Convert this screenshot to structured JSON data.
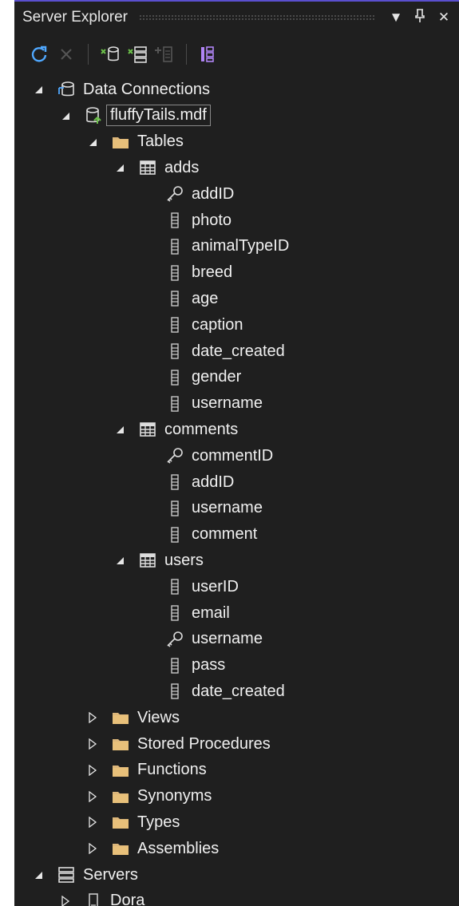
{
  "panel": {
    "title": "Server Explorer",
    "title_icons": [
      "dropdown-arrow-icon",
      "pin-icon",
      "close-icon"
    ],
    "title_glyphs": [
      "▼",
      "🖈",
      "✕"
    ]
  },
  "toolbar": {
    "tools": [
      "refresh-icon",
      "stop-icon",
      "connect-to-database-icon",
      "connect-to-server-icon",
      "add-sharepoint-connection-icon",
      "filter-icon"
    ]
  },
  "tree": [
    {
      "label": "Data Connections",
      "icon": "data-connections",
      "arrow": "expanded",
      "level": 0
    },
    {
      "label": "fluffyTails.mdf",
      "icon": "database",
      "arrow": "expanded",
      "level": 1,
      "selected": true
    },
    {
      "label": "Tables",
      "icon": "folder",
      "arrow": "expanded",
      "level": 2
    },
    {
      "label": "adds",
      "icon": "table",
      "arrow": "expanded",
      "level": 3
    },
    {
      "label": "addID",
      "icon": "key",
      "arrow": "none",
      "level": 4
    },
    {
      "label": "photo",
      "icon": "column",
      "arrow": "none",
      "level": 4
    },
    {
      "label": "animalTypeID",
      "icon": "column",
      "arrow": "none",
      "level": 4
    },
    {
      "label": "breed",
      "icon": "column",
      "arrow": "none",
      "level": 4
    },
    {
      "label": "age",
      "icon": "column",
      "arrow": "none",
      "level": 4
    },
    {
      "label": "caption",
      "icon": "column",
      "arrow": "none",
      "level": 4
    },
    {
      "label": "date_created",
      "icon": "column",
      "arrow": "none",
      "level": 4
    },
    {
      "label": "gender",
      "icon": "column",
      "arrow": "none",
      "level": 4
    },
    {
      "label": "username",
      "icon": "column",
      "arrow": "none",
      "level": 4
    },
    {
      "label": "comments",
      "icon": "table",
      "arrow": "expanded",
      "level": 3
    },
    {
      "label": "commentID",
      "icon": "key",
      "arrow": "none",
      "level": 4
    },
    {
      "label": "addID",
      "icon": "column",
      "arrow": "none",
      "level": 4
    },
    {
      "label": "username",
      "icon": "column",
      "arrow": "none",
      "level": 4
    },
    {
      "label": "comment",
      "icon": "column",
      "arrow": "none",
      "level": 4
    },
    {
      "label": "users",
      "icon": "table",
      "arrow": "expanded",
      "level": 3
    },
    {
      "label": "userID",
      "icon": "column",
      "arrow": "none",
      "level": 4
    },
    {
      "label": "email",
      "icon": "column",
      "arrow": "none",
      "level": 4
    },
    {
      "label": "username",
      "icon": "key",
      "arrow": "none",
      "level": 4
    },
    {
      "label": "pass",
      "icon": "column",
      "arrow": "none",
      "level": 4
    },
    {
      "label": "date_created",
      "icon": "column",
      "arrow": "none",
      "level": 4
    },
    {
      "label": "Views",
      "icon": "folder",
      "arrow": "collapsed",
      "level": 2
    },
    {
      "label": "Stored Procedures",
      "icon": "folder",
      "arrow": "collapsed",
      "level": 2
    },
    {
      "label": "Functions",
      "icon": "folder",
      "arrow": "collapsed",
      "level": 2
    },
    {
      "label": "Synonyms",
      "icon": "folder",
      "arrow": "collapsed",
      "level": 2
    },
    {
      "label": "Types",
      "icon": "folder",
      "arrow": "collapsed",
      "level": 2
    },
    {
      "label": "Assemblies",
      "icon": "folder",
      "arrow": "collapsed",
      "level": 2
    },
    {
      "label": "Servers",
      "icon": "servers",
      "arrow": "expanded",
      "level": 0
    },
    {
      "label": "Dora",
      "icon": "server",
      "arrow": "collapsed",
      "level": 1
    }
  ],
  "colors": {
    "background": "#1f1f1f",
    "text": "#f0f0f0",
    "folder": "#dcb67a",
    "icon_gray": "#c8c8c8",
    "accent_blue": "#4fa8ff",
    "accent_green": "#6cc04a",
    "accent_purple": "#b084f5"
  }
}
